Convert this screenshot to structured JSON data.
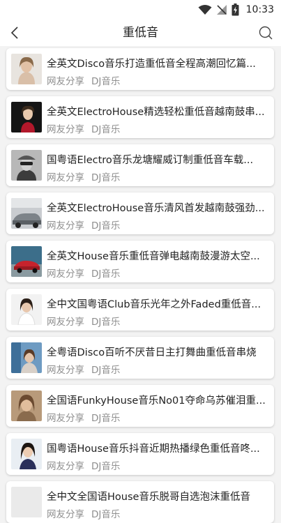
{
  "status": {
    "time": "10:33"
  },
  "header": {
    "title": "重低音"
  },
  "items": [
    {
      "title": "全英文Disco音乐打造重低音全程高潮回忆篇...",
      "source": "网友分享",
      "category": "DJ音乐"
    },
    {
      "title": "全英文ElectroHouse精选轻松重低音越南鼓串...",
      "source": "网友分享",
      "category": "DJ音乐"
    },
    {
      "title": "国粤语Electro音乐龙塘耀威订制重低音车载...",
      "source": "网友分享",
      "category": "DJ音乐"
    },
    {
      "title": "全英文ElectroHouse音乐清风首发越南鼓强劲...",
      "source": "网友分享",
      "category": "DJ音乐"
    },
    {
      "title": "全英文House音乐重低音弹电越南鼓漫游太空...",
      "source": "网友分享",
      "category": "DJ音乐"
    },
    {
      "title": "全中文国粤语Club音乐光年之外Faded重低音...",
      "source": "网友分享",
      "category": "DJ音乐"
    },
    {
      "title": "全粤语Disco百听不厌昔日主打舞曲重低音串烧",
      "source": "网友分享",
      "category": "DJ音乐"
    },
    {
      "title": "全国语FunkyHouse音乐No01夺命乌苏催泪重...",
      "source": "网友分享",
      "category": "DJ音乐"
    },
    {
      "title": "国粤语House音乐抖音近期热播绿色重低音咚...",
      "source": "网友分享",
      "category": "DJ音乐"
    },
    {
      "title": "全中文全国语House音乐脱哥自选泡沫重低音",
      "source": "网友分享",
      "category": "DJ音乐"
    }
  ]
}
